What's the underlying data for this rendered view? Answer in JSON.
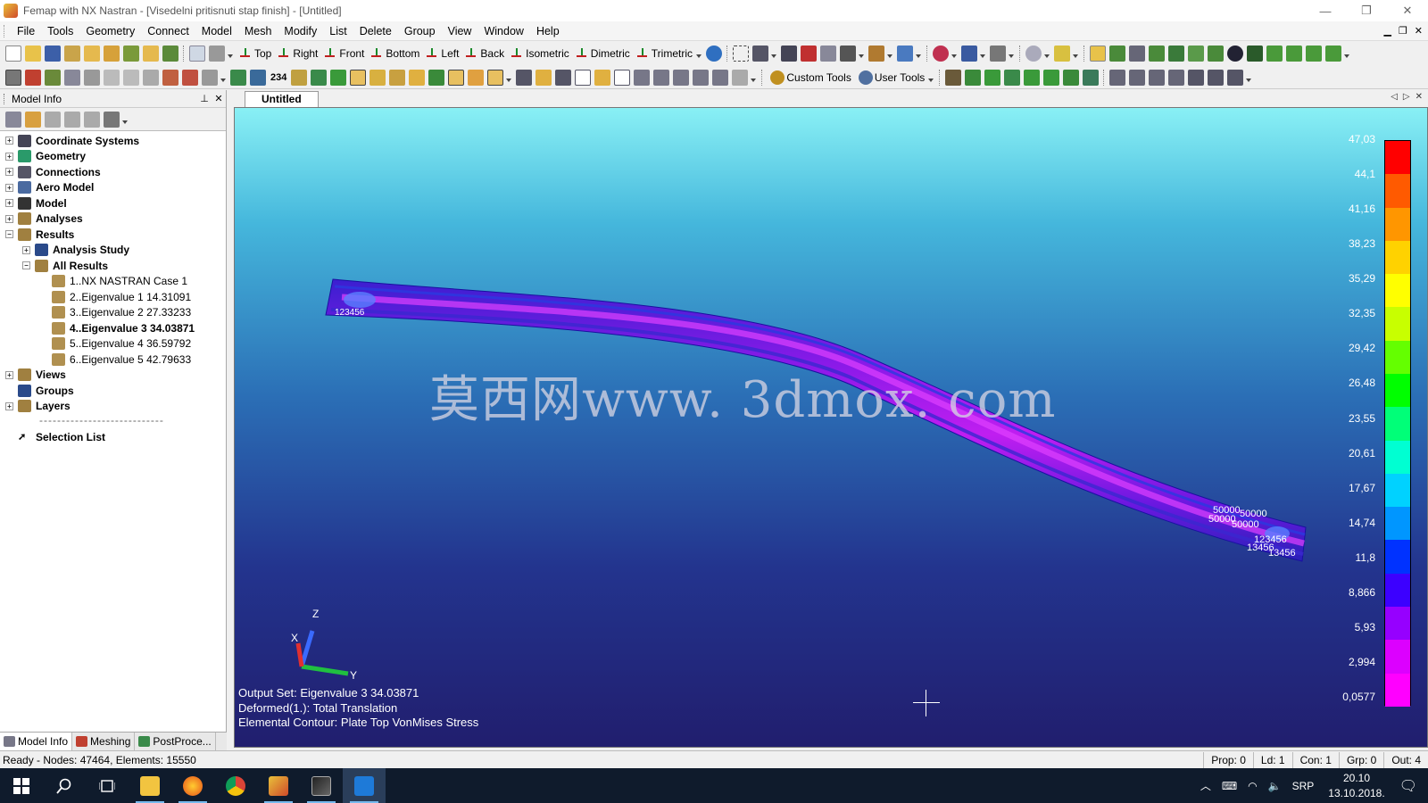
{
  "window": {
    "title": "Femap with NX Nastran - [Visedelni pritisnuti stap finish] - [Untitled]",
    "controls": [
      "—",
      "❐",
      "✕"
    ]
  },
  "menu": [
    "File",
    "Tools",
    "Geometry",
    "Connect",
    "Model",
    "Mesh",
    "Modify",
    "List",
    "Delete",
    "Group",
    "View",
    "Window",
    "Help"
  ],
  "toolbar1": {
    "views": [
      "Top",
      "Right",
      "Front",
      "Bottom",
      "Left",
      "Back",
      "Isometric",
      "Dimetric",
      "Trimetric"
    ]
  },
  "toolbar2": {
    "custom_tools": "Custom Tools",
    "user_tools": "User Tools",
    "counter": "234"
  },
  "model_info": {
    "title": "Model Info",
    "tree": [
      {
        "label": "Coordinate Systems",
        "level": 0,
        "exp": "+"
      },
      {
        "label": "Geometry",
        "level": 0,
        "exp": "+"
      },
      {
        "label": "Connections",
        "level": 0,
        "exp": "+"
      },
      {
        "label": "Aero Model",
        "level": 0,
        "exp": "+"
      },
      {
        "label": "Model",
        "level": 0,
        "exp": "+"
      },
      {
        "label": "Analyses",
        "level": 0,
        "exp": "+"
      },
      {
        "label": "Results",
        "level": 0,
        "exp": "−"
      },
      {
        "label": "Analysis Study",
        "level": 1,
        "exp": "+"
      },
      {
        "label": "All Results",
        "level": 1,
        "exp": "−"
      },
      {
        "label": "1..NX NASTRAN Case 1",
        "level": 2,
        "exp": ""
      },
      {
        "label": "2..Eigenvalue 1 14.31091",
        "level": 2,
        "exp": ""
      },
      {
        "label": "3..Eigenvalue 2 27.33233",
        "level": 2,
        "exp": ""
      },
      {
        "label": "4..Eigenvalue 3 34.03871",
        "level": 2,
        "exp": "",
        "selected": true
      },
      {
        "label": "5..Eigenvalue 4 36.59792",
        "level": 2,
        "exp": ""
      },
      {
        "label": "6..Eigenvalue 5 42.79633",
        "level": 2,
        "exp": ""
      },
      {
        "label": "Views",
        "level": 0,
        "exp": "+"
      },
      {
        "label": "Groups",
        "level": 0,
        "exp": ""
      },
      {
        "label": "Layers",
        "level": 0,
        "exp": "+"
      }
    ],
    "separator": "----------------------------",
    "selection_list": "Selection List",
    "tabs": [
      "Model Info",
      "Meshing",
      "PostProce..."
    ]
  },
  "document": {
    "tab": "Untitled",
    "watermark": "莫西网www. 3dmox. com",
    "info_lines": [
      "Output Set: Eigenvalue 3 34.03871",
      "Deformed(1.): Total Translation",
      "Elemental Contour: Plate Top VonMises Stress"
    ],
    "node_labels": {
      "left": "123456",
      "right_a": "50000",
      "right_b": "50000",
      "right_c": "50000",
      "right_d": "50000",
      "right_e": "123456",
      "right_f": "13456",
      "right_g": "13456"
    },
    "axes": {
      "x": "X",
      "y": "Y",
      "z": "Z"
    },
    "legend": {
      "values": [
        "47,03",
        "44,1",
        "41,16",
        "38,23",
        "35,29",
        "32,35",
        "29,42",
        "26,48",
        "23,55",
        "20,61",
        "17,67",
        "14,74",
        "11,8",
        "8,866",
        "5,93",
        "2,994",
        "0,0577"
      ],
      "colors": [
        "#ff0000",
        "#ff5a00",
        "#ff9600",
        "#ffd200",
        "#ffff00",
        "#c8ff00",
        "#64ff00",
        "#00ff00",
        "#00ff78",
        "#00ffd2",
        "#00d2ff",
        "#0096ff",
        "#0032ff",
        "#3c00ff",
        "#9600ff",
        "#dc00ff",
        "#ff00ff"
      ]
    }
  },
  "status": {
    "main": "Ready - Nodes: 47464,  Elements: 15550",
    "prop": "Prop: 0",
    "ld": "Ld: 1",
    "con": "Con: 1",
    "grp": "Grp: 0",
    "out": "Out: 4"
  },
  "taskbar": {
    "lang": "SRP",
    "time": "20.10",
    "date": "13.10.2018."
  }
}
